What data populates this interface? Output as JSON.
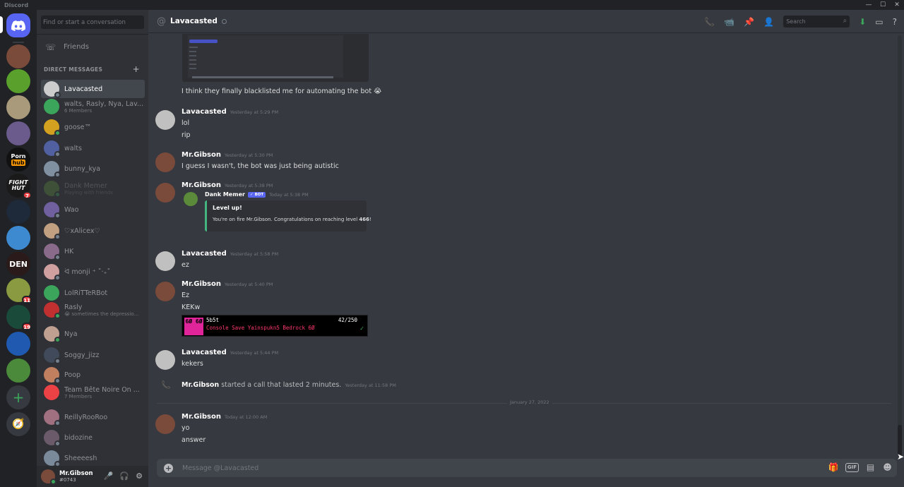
{
  "app": {
    "title": "Discord"
  },
  "window_controls": [
    "—",
    "☐",
    "✕"
  ],
  "servers": {
    "home_icon": "discord-logo-icon",
    "items": [
      {
        "name": "server-1",
        "color": "#7a4a3a",
        "badge": ""
      },
      {
        "name": "server-2",
        "color": "#5aa02c",
        "badge": ""
      },
      {
        "name": "server-3",
        "color": "#a89a7a",
        "badge": ""
      },
      {
        "name": "server-4",
        "color": "#6b5b8c",
        "badge": ""
      },
      {
        "name": "server-5",
        "color": "#111111",
        "badge": "",
        "text": "Porn hub"
      },
      {
        "name": "server-6",
        "color": "#1a1a1a",
        "badge": "7",
        "text": "FIGHT HUT"
      },
      {
        "name": "server-7",
        "color": "#1e2a3a",
        "badge": ""
      },
      {
        "name": "server-8",
        "color": "#3d8ad0",
        "badge": ""
      },
      {
        "name": "server-9",
        "color": "#2a1a1a",
        "badge": "",
        "text": "DEN"
      },
      {
        "name": "server-10",
        "color": "#8a9a40",
        "badge": "11"
      },
      {
        "name": "server-11",
        "color": "#1a4a3a",
        "badge": "19"
      },
      {
        "name": "server-12",
        "color": "#1f5ab0",
        "badge": ""
      },
      {
        "name": "server-13",
        "color": "#4a8a3a",
        "badge": ""
      }
    ],
    "add_server": "+",
    "explore": "compass-icon"
  },
  "dm": {
    "search_placeholder": "Find or start a conversation",
    "friends_label": "Friends",
    "header": "DIRECT MESSAGES",
    "add": "+",
    "items": [
      {
        "name": "Lavacasted",
        "sub": "",
        "color": "#cccccc",
        "status": "offline"
      },
      {
        "name": "walts, Rasly, Nya, Lav...",
        "sub": "6 Members",
        "color": "#3ba55c",
        "status": "none"
      },
      {
        "name": "goose™",
        "sub": "",
        "color": "#d4a020",
        "status": "online"
      },
      {
        "name": "walts",
        "sub": "",
        "color": "#5060a0",
        "status": "offline"
      },
      {
        "name": "bunny_kya",
        "sub": "",
        "color": "#8090a0",
        "status": "offline"
      },
      {
        "name": "Dank Memer",
        "sub": "Playing with friends",
        "color": "#5a8a3a",
        "status": "online"
      },
      {
        "name": "Wao",
        "sub": "",
        "color": "#7060a0",
        "status": "offline"
      },
      {
        "name": "♡xAlicex♡",
        "sub": "",
        "color": "#c0a080",
        "status": "offline"
      },
      {
        "name": "HK",
        "sub": "",
        "color": "#8a6a8a",
        "status": "offline"
      },
      {
        "name": "ᐛ monji ⁺ ˚‧₊˚",
        "sub": "",
        "color": "#d0a0a0",
        "status": "offline"
      },
      {
        "name": "LolRiTTeRBot",
        "sub": "",
        "color": "#3ba55c",
        "status": "none"
      },
      {
        "name": "Rasly",
        "sub": "😭 sometimes the depressio...",
        "color": "#c03030",
        "status": "online"
      },
      {
        "name": "Nya",
        "sub": "",
        "color": "#c0a090",
        "status": "online"
      },
      {
        "name": "Soggy_jizz",
        "sub": "",
        "color": "#404a5a",
        "status": "offline"
      },
      {
        "name": "Poop",
        "sub": "",
        "color": "#c08060",
        "status": "offline"
      },
      {
        "name": "Team Bête Noire On ...",
        "sub": "7 Members",
        "color": "#ed4245",
        "status": "none"
      },
      {
        "name": "ReillyRooRoo",
        "sub": "",
        "color": "#a07080",
        "status": "offline"
      },
      {
        "name": "bidozine",
        "sub": "",
        "color": "#6a5a6a",
        "status": "offline"
      },
      {
        "name": "Sheeeesh",
        "sub": "",
        "color": "#7a8a9a",
        "status": "offline"
      }
    ]
  },
  "user": {
    "name": "Mr.Gibson",
    "tag": "#0743"
  },
  "chat": {
    "channel": "Lavacasted",
    "search_placeholder": "Search",
    "composer_placeholder": "Message @Lavacasted",
    "messages": {
      "m0_line": "I think they finally blacklisted me for automating the bot 😭",
      "m1_author": "Lavacasted",
      "m1_ts": "Yesterday at 5:29 PM",
      "m1_l1": "lol",
      "m1_l2": "rip",
      "m2_author": "Mr.Gibson",
      "m2_ts": "Yesterday at 5:30 PM",
      "m2_l1": "I guess I wasn't, the bot was just being autistic",
      "m3_author": "Mr.Gibson",
      "m3_ts": "Yesterday at 5:38 PM",
      "m3_embed_author": "Dank Memer",
      "m3_embed_badge": "✓ BOT",
      "m3_embed_ts": "Today at 5:38 PM",
      "m3_embed_title": "Level up!",
      "m3_embed_desc_pre": "You're on fire Mr.Gibson. Congratulations on reaching level ",
      "m3_embed_level": "466",
      "m3_embed_desc_post": "!",
      "m4_author": "Lavacasted",
      "m4_ts": "Yesterday at 5:58 PM",
      "m4_l1": "ez",
      "m5_author": "Mr.Gibson",
      "m5_ts": "Yesterday at 5:40 PM",
      "m5_l1": "Ez",
      "m5_l2": "KEKw",
      "m5_gif_pix": "6Ø 6Ø",
      "m5_gif_l1": "5b5t",
      "m5_gif_l2": "Console Save Yainspukn5 Bedrock 6Ø",
      "m5_gif_r1": "42/250",
      "m6_author": "Lavacasted",
      "m6_ts": "Yesterday at 5:44 PM",
      "m6_l1": "kekers",
      "call_author": "Mr.Gibson",
      "call_text": " started a call that lasted 2 minutes.",
      "call_ts": "Yesterday at 11:58 PM",
      "date_divider": "January 27, 2022",
      "m7_author": "Mr.Gibson",
      "m7_ts": "Today at 12:00 AM",
      "m7_l1": "yo",
      "m7_l2": "answer"
    }
  }
}
